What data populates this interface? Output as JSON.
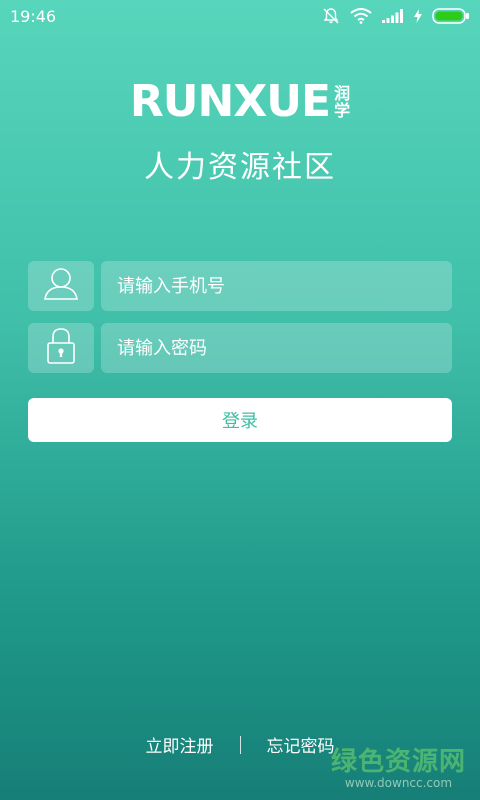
{
  "status_bar": {
    "time": "19:46",
    "icons": [
      "bell-off-icon",
      "wifi-icon",
      "signal-icon",
      "charging-icon",
      "battery-icon"
    ]
  },
  "logo": {
    "word": "RUNXUE",
    "cn_top": "润",
    "cn_bottom": "学"
  },
  "subtitle": "人力资源社区",
  "form": {
    "phone_icon": "user-icon",
    "phone_placeholder": "请输入手机号",
    "password_icon": "lock-icon",
    "password_placeholder": "请输入密码",
    "login_label": "登录"
  },
  "footer": {
    "register_label": "立即注册",
    "forgot_label": "忘记密码"
  },
  "watermark": {
    "text": "绿色资源网",
    "url": "www.downcc.com"
  },
  "colors": {
    "accent": "#3dbfa4",
    "gradient_top": "#57d6bc",
    "gradient_bottom": "#167f77"
  }
}
